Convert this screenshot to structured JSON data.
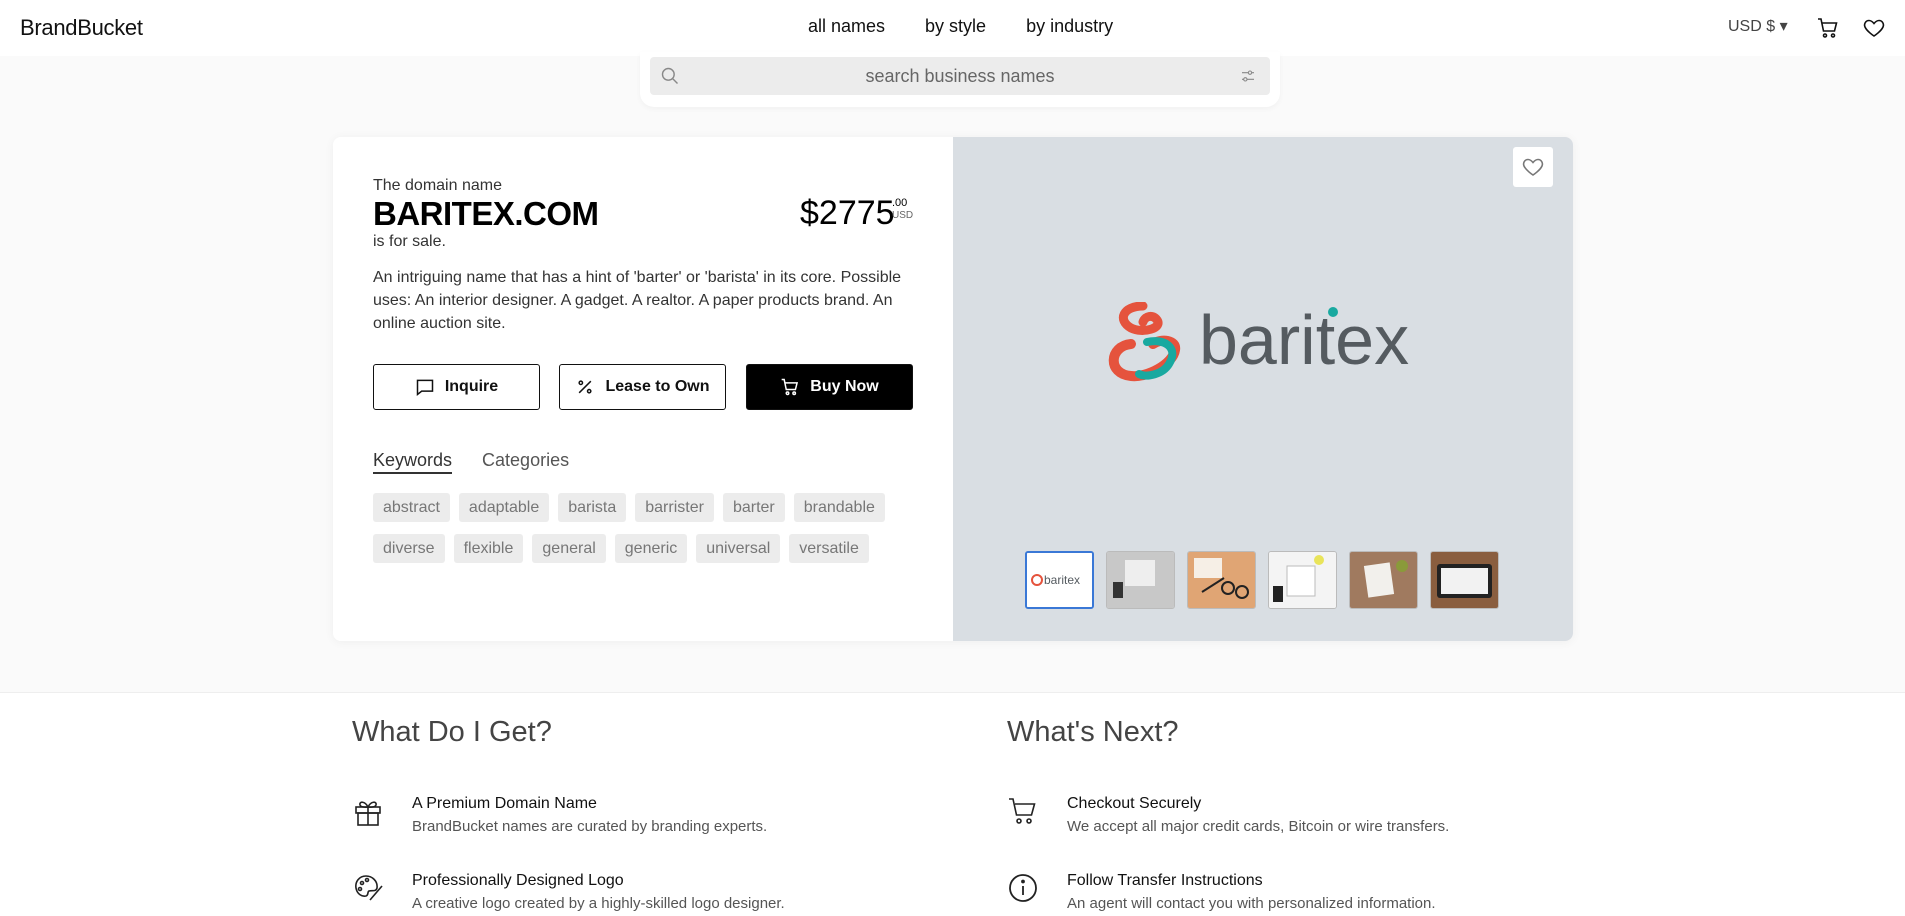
{
  "header": {
    "logo": "BrandBucket",
    "nav": [
      "all names",
      "by style",
      "by industry"
    ],
    "currency": "USD $ ▾"
  },
  "search": {
    "placeholder": "search business names"
  },
  "listing": {
    "pre_label": "The domain name",
    "domain": "BARITEX.COM",
    "post_label": "is for sale.",
    "price": "$2775",
    "price_cents": ".00",
    "price_currency": "USD",
    "description": "An intriguing name that has a hint of 'barter' or 'barista' in its core. Possible uses: An interior designer. A gadget. A realtor. A paper products brand. An online auction site.",
    "buttons": {
      "inquire": "Inquire",
      "lease": "Lease to Own",
      "buy": "Buy Now"
    },
    "tabs": [
      "Keywords",
      "Categories"
    ],
    "keywords": [
      "abstract",
      "adaptable",
      "barista",
      "barrister",
      "barter",
      "brandable",
      "diverse",
      "flexible",
      "general",
      "generic",
      "universal",
      "versatile"
    ]
  },
  "preview": {
    "logo_text": "baritex",
    "thumbnails": [
      "logo",
      "desk-phone",
      "glasses-pen",
      "notebook-desk",
      "paper-cup",
      "tablet"
    ],
    "colors": {
      "accent_red": "#e5533d",
      "accent_teal": "#19a9a0",
      "logo_gray": "#555b60",
      "panel": "#d9dee3"
    }
  },
  "what_do_i_get": {
    "title": "What Do I Get?",
    "items": [
      {
        "icon": "gift-icon",
        "title": "A Premium Domain Name",
        "desc": "BrandBucket names are curated by branding experts."
      },
      {
        "icon": "palette-icon",
        "title": "Professionally Designed Logo",
        "desc": "A creative logo created by a highly-skilled logo designer."
      }
    ]
  },
  "whats_next": {
    "title": "What's Next?",
    "items": [
      {
        "icon": "cart-icon",
        "title": "Checkout Securely",
        "desc": "We accept all major credit cards, Bitcoin or wire transfers."
      },
      {
        "icon": "info-icon",
        "title": "Follow Transfer Instructions",
        "desc": "An agent will contact you with personalized information."
      }
    ]
  }
}
